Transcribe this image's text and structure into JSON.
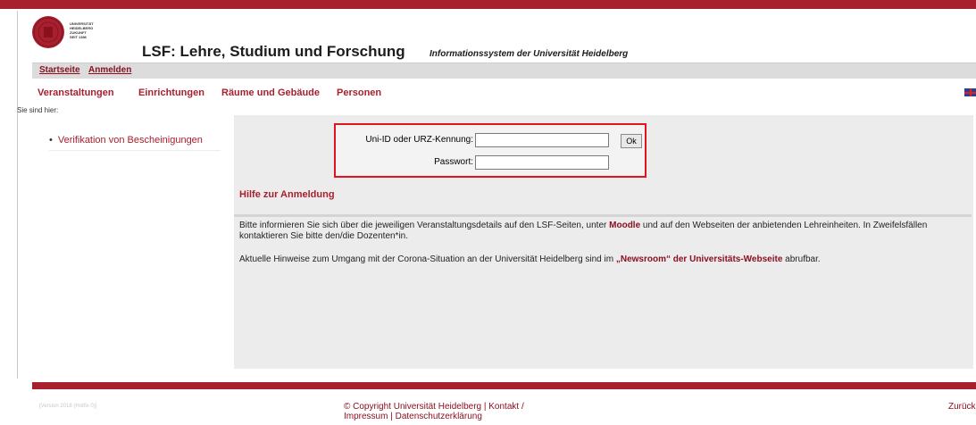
{
  "header": {
    "logo_lines": [
      "UNIVERSITÄT",
      "HEIDELBERG",
      "ZUKUNFT",
      "SEIT 1386"
    ],
    "title": "LSF: Lehre, Studium und Forschung",
    "subtitle": "Informationssystem der Universität Heidelberg"
  },
  "menubar": {
    "start": "Startseite",
    "login": "Anmelden"
  },
  "nav": [
    "Veranstaltungen",
    "Einrichtungen",
    "Räume und Gebäude",
    "Personen"
  ],
  "breadcrumb": "Sie sind hier:",
  "sidebar": {
    "items": [
      "Verifikation von Bescheinigungen"
    ]
  },
  "login": {
    "uid_label": "Uni-ID oder URZ-Kennung:",
    "uid_value": "",
    "pw_label": "Passwort:",
    "pw_value": "",
    "ok_label": "Ok"
  },
  "help_link": "Hilfe zur Anmeldung",
  "info": {
    "p1_pre": "Bitte informieren Sie sich über die jeweiligen Veranstaltungsdetails auf den LSF-Seiten, unter ",
    "p1_link": "Moodle",
    "p1_post": " und auf den Webseiten der anbietenden Lehreinheiten. In Zweifelsfällen kontaktieren Sie bitte den/die Dozenten*in.",
    "p2_pre": "Aktuelle Hinweise zum Umgang mit der Corona-Situation an der Universität Heidelberg sind im ",
    "p2_link": "„Newsroom“ der Universitäts-Webseite",
    "p2_post": " abrufbar."
  },
  "footer": {
    "meta": "[Version 2018 (Hotfix 0)]",
    "copyright": "© Copyright Universität Heidelberg | Kontakt /",
    "copyright2": "Impressum | Datenschutzerklärung",
    "back": "Zurück"
  },
  "colors": {
    "brand": "#a8202e",
    "highlight": "#e0141e",
    "panel": "#ececec"
  }
}
